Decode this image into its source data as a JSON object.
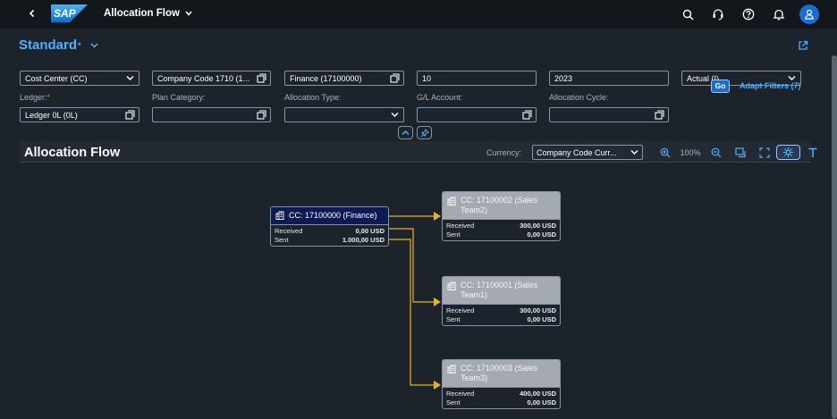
{
  "shell": {
    "app_title": "Allocation Flow",
    "logo_text": "SAP",
    "icons": [
      "search-icon",
      "headset-icon",
      "help-icon",
      "bell-icon",
      "user-icon"
    ]
  },
  "header": {
    "variant_name": "Standard",
    "variant_modified_mark": "*"
  },
  "filters": {
    "row1": [
      {
        "value": "Cost Center (CC)",
        "icon": "chevron-down-icon"
      },
      {
        "value": "Company Code 1710 (1...",
        "icon": "value-help-icon"
      },
      {
        "value": "Finance (17100000)",
        "icon": "value-help-icon"
      },
      {
        "value": "10",
        "icon": ""
      },
      {
        "value": "2023",
        "icon": ""
      },
      {
        "value": "Actual (I)",
        "icon": "chevron-down-icon"
      }
    ],
    "labels": {
      "ledger": "Ledger:",
      "ledger_required": "*",
      "plan_category": "Plan Category:",
      "allocation_type": "Allocation Type:",
      "gl_account": "G/L Account:",
      "allocation_cycle": "Allocation Cycle:"
    },
    "row2": {
      "ledger": "Ledger 0L (0L)",
      "plan_category": "",
      "allocation_type": "",
      "gl_account": "",
      "allocation_cycle": ""
    },
    "go_label": "Go",
    "adapt_label": "Adapt Filters (7)"
  },
  "panel": {
    "title": "Allocation Flow",
    "currency_label": "Currency:",
    "currency_value": "Company Code Curr...",
    "zoom_level": "100%"
  },
  "nodes": {
    "root": {
      "title": "CC: 17100000 (Finance)",
      "received_label": "Received",
      "received": "0,00 USD",
      "sent_label": "Sent",
      "sent": "1.000,00 USD"
    },
    "t1": {
      "title": "CC: 17100002 (Sales Team2)",
      "received_label": "Received",
      "received": "300,00 USD",
      "sent_label": "Sent",
      "sent": "0,00 USD"
    },
    "t2": {
      "title": "CC: 17100001 (Sales Team1)",
      "received_label": "Received",
      "received": "300,00 USD",
      "sent_label": "Sent",
      "sent": "0,00 USD"
    },
    "t3": {
      "title": "CC: 17100003 (Sales Team3)",
      "received_label": "Received",
      "received": "400,00 USD",
      "sent_label": "Sent",
      "sent": "0,00 USD"
    }
  },
  "colors": {
    "accent": "#4db1ff",
    "edge": "#e8b41e",
    "root_header": "#0d1b52",
    "target_header": "#a4aab0"
  }
}
